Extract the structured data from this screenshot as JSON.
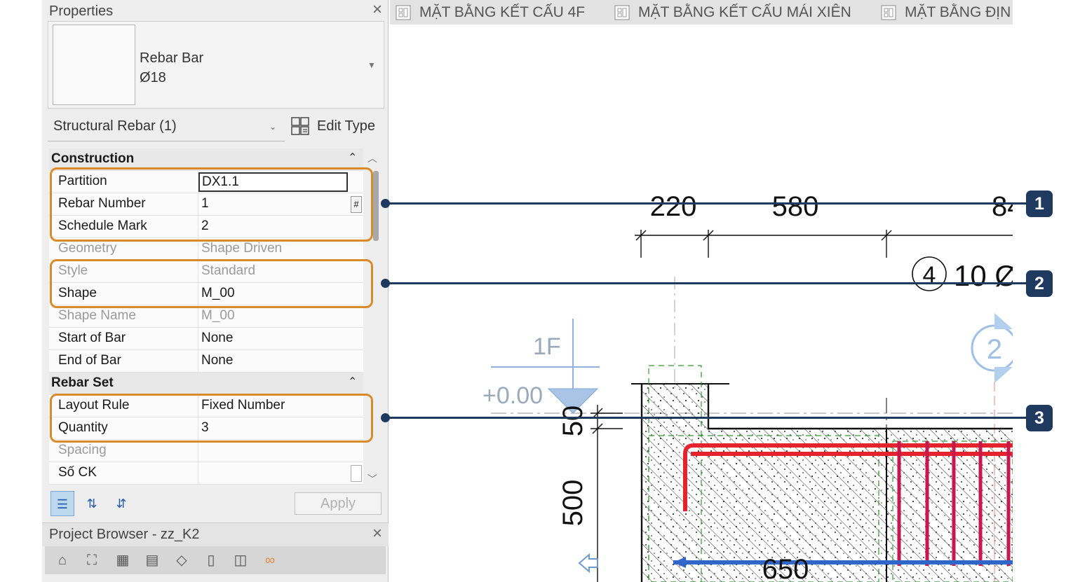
{
  "properties_panel": {
    "title": "Properties",
    "type_selector": {
      "family": "Rebar Bar",
      "type": "Ø18"
    },
    "instance_filter": "Structural Rebar (1)",
    "edit_type_label": "Edit Type",
    "groups": [
      {
        "name": "Construction",
        "rows": [
          {
            "label": "Partition",
            "value": "DX1.1"
          },
          {
            "label": "Rebar Number",
            "value": "1"
          },
          {
            "label": "Schedule Mark",
            "value": "2"
          },
          {
            "label": "Geometry",
            "value": "Shape Driven"
          },
          {
            "label": "Style",
            "value": "Standard"
          },
          {
            "label": "Shape",
            "value": "M_00"
          },
          {
            "label": "Shape Name",
            "value": "M_00"
          },
          {
            "label": "Start of Bar",
            "value": "None"
          },
          {
            "label": "End of Bar",
            "value": "None"
          }
        ]
      },
      {
        "name": "Rebar Set",
        "rows": [
          {
            "label": "Layout Rule",
            "value": "Fixed Number"
          },
          {
            "label": "Quantity",
            "value": "3"
          },
          {
            "label": "Spacing",
            "value": ""
          },
          {
            "label": "Số CK",
            "value": ""
          }
        ]
      }
    ],
    "apply_label": "Apply"
  },
  "project_browser": {
    "title": "Project Browser - zz_K2"
  },
  "view_tabs": [
    {
      "label": "MẶT BẰNG KẾT CẤU 4F"
    },
    {
      "label": "MẶT BẰNG KẾT CẤU MÁI XIÊN"
    },
    {
      "label": "MẶT BẰNG ĐỊN"
    }
  ],
  "drawing": {
    "dim_top": [
      "220",
      "580",
      "84"
    ],
    "rebar_tag_number": "4",
    "rebar_tag_text": "10 Ø",
    "level_name": "1F",
    "level_elevation": "+0.00",
    "dim_vertical": [
      "50",
      "500"
    ],
    "dim_bottom": "650",
    "section_tag": "2"
  },
  "callouts": [
    "1",
    "2",
    "3"
  ],
  "colors": {
    "highlight": "#d98a2b",
    "callout": "#1f3a5f",
    "rebar": "#e5232e",
    "stirrup": "#c8164e",
    "bottom_bar": "#2f66c9"
  }
}
